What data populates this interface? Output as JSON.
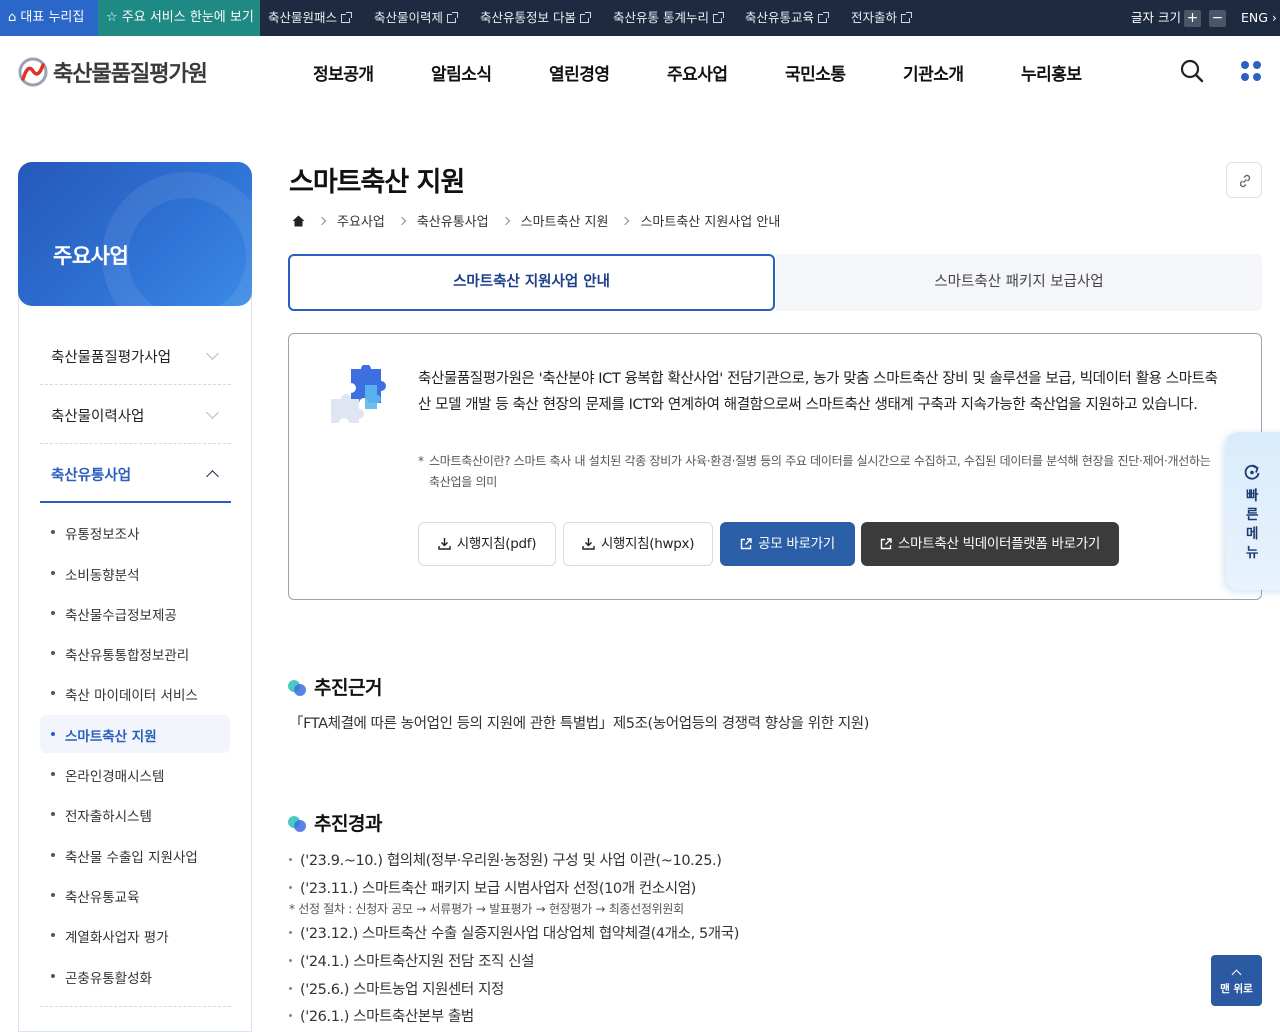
{
  "util_bar": {
    "home_label": "대표 누리집",
    "service_label": "주요 서비스 한눈에 보기",
    "links": [
      "축산물원패스",
      "축산물이력제",
      "축산유통정보 다봄",
      "축산유통 통계누리",
      "축산유통교육",
      "전자출하"
    ],
    "font_size_label": "글자 크기",
    "plus": "+",
    "minus": "−",
    "lang": "ENG"
  },
  "header": {
    "logo_text": "축산물품질평가원",
    "gnb": [
      "정보공개",
      "알림소식",
      "열린경영",
      "주요사업",
      "국민소통",
      "기관소개",
      "누리홍보"
    ]
  },
  "lnb": {
    "title": "주요사업",
    "depth1": [
      {
        "label": "축산물품질평가사업"
      },
      {
        "label": "축산물이력사업"
      },
      {
        "label": "축산유통사업"
      }
    ],
    "sub": [
      "유통정보조사",
      "소비동향분석",
      "축산물수급정보제공",
      "축산유통통합정보관리",
      "축산 마이데이터 서비스",
      "스마트축산 지원",
      "온라인경매시스템",
      "전자출하시스템",
      "축산물 수출입 지원사업",
      "축산유통교육",
      "계열화사업자 평가",
      "곤충유통활성화"
    ]
  },
  "page": {
    "title": "스마트축산 지원",
    "breadcrumb": [
      "주요사업",
      "축산유통사업",
      "스마트축산 지원",
      "스마트축산 지원사업 안내"
    ],
    "tabs": [
      "스마트축산 지원사업 안내",
      "스마트축산 패키지 보급사업"
    ]
  },
  "intro": {
    "text": "축산물품질평가원은 '축산분야 ICT 융복합 확산사업' 전담기관으로, 농가 맞춤 스마트축산 장비 및 솔루션을 보급, 빅데이터 활용 스마트축산 모델 개발 등 축산 현장의 문제를 ICT와 연계하여 해결함으로써 스마트축산 생태계 구축과 지속가능한 축산업을 지원하고 있습니다.",
    "note_star": "*",
    "note": "스마트축산이란? 스마트 축사 내 설치된 각종 장비가 사육·환경·질병 등의 주요 데이터를 실시간으로 수집하고, 수집된 데이터를 분석해 현장을 진단·제어·개선하는 축산업을 의미",
    "buttons": [
      "시행지침(pdf)",
      "시행지침(hwpx)",
      "공모 바로가기",
      "스마트축산 빅데이터플랫폼 바로가기"
    ]
  },
  "basis": {
    "title": "추진근거",
    "text": "「FTA체결에 따른 농어업인 등의 지원에 관한 특별법」제5조(농어업등의 경쟁력 향상을 위한 지원)"
  },
  "results": {
    "title": "추진경과",
    "items": [
      "('23.9.~10.) 협의체(정부·우리원·농정원) 구성 및 사업 이관(~10.25.)",
      "('23.11.) 스마트축산 패키지 보급 시범사업자 선정(10개 컨소시엄)",
      "('23.12.) 스마트축산 수출 실증지원사업 대상업체 협약체결(4개소, 5개국)",
      "('24.1.) 스마트축산지원 전담 조직 신설",
      "('25.6.) 스마트농업 지원센터 지정",
      "('26.1.) 스마트축산본부 출범"
    ],
    "note": "* 선정 절차 : 신청자 공모 → 서류평가 → 발표평가 → 현장평가 → 최종선정위원회"
  },
  "floating": {
    "quick_menu": "빠른메뉴",
    "top": "맨 위로"
  },
  "colors": {
    "primary": "#2a5fbf",
    "util_bg": "#1d2a3f",
    "home_tab": "#2a67c8",
    "service_tab": "#1f8a84",
    "dark_button": "#3b3b3b"
  }
}
